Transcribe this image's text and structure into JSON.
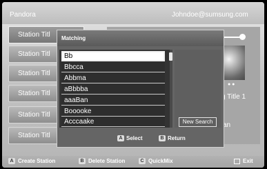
{
  "header": {
    "app_title": "Pandora",
    "account": "Johndoe@sumsung.com"
  },
  "stations": [
    {
      "label": "Station Titl"
    },
    {
      "label": "Station Titl"
    },
    {
      "label": "Station Titl"
    },
    {
      "label": "Station Titl"
    },
    {
      "label": "Station Titl"
    },
    {
      "label": "Station Titl"
    }
  ],
  "player": {
    "song_title": "g Title 1",
    "artist_fragment": "an"
  },
  "dialog": {
    "title": "Matching",
    "items": [
      "Bb",
      "Bbcca",
      "Abbma",
      "aBbbba",
      "aaaBan",
      "Booooke",
      "Acccaake"
    ],
    "new_search_label": "New Search",
    "footer": {
      "select": {
        "key": "A",
        "label": "Select"
      },
      "return": {
        "key": "B",
        "label": "Return"
      }
    }
  },
  "bottom_bar": {
    "create": {
      "key": "A",
      "label": "Create Station"
    },
    "delete": {
      "key": "B",
      "label": "Delete Station"
    },
    "quickmix": {
      "key": "C",
      "label": "QuickMix"
    },
    "exit": {
      "label": "Exit"
    }
  }
}
